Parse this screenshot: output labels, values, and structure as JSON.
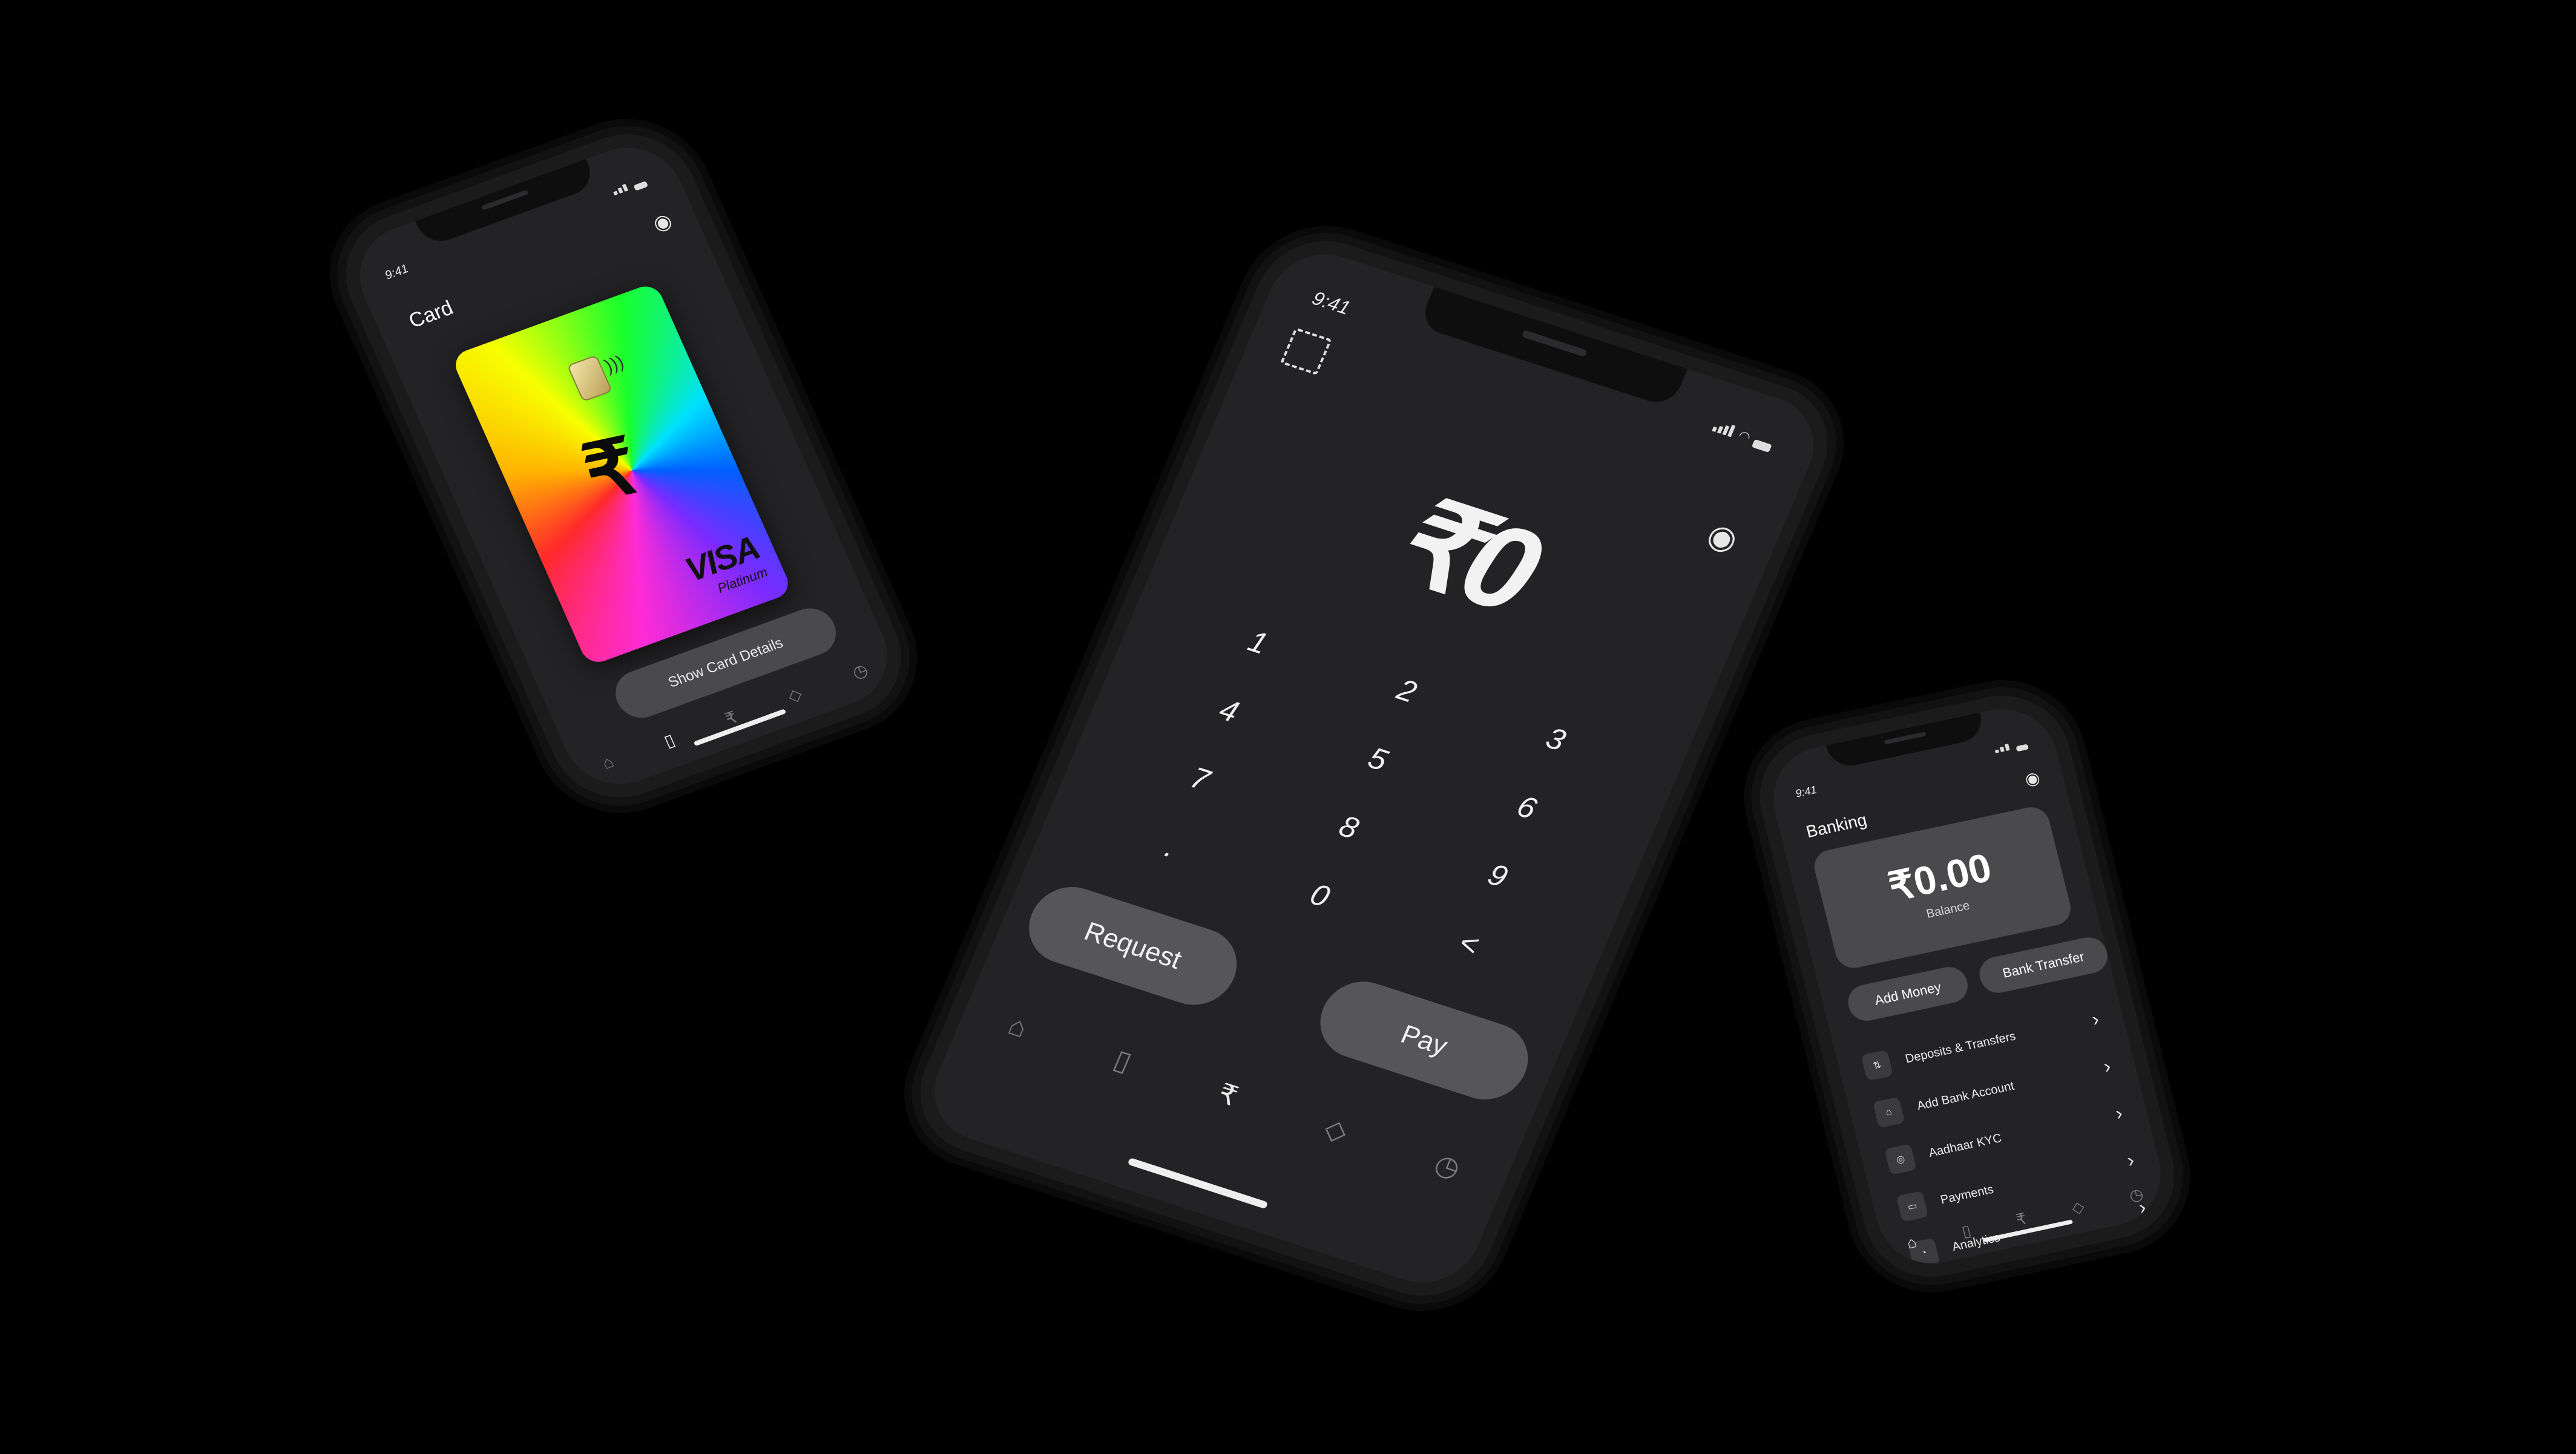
{
  "status_time": "9:41",
  "left_phone": {
    "title": "Card",
    "card": {
      "brand": "VISA",
      "tier": "Platinum",
      "symbol": "₹"
    },
    "show_details_label": "Show Card Details",
    "tabs": [
      {
        "icon": "home-icon",
        "glyph": "⌂",
        "active": false
      },
      {
        "icon": "card-icon",
        "glyph": "▯",
        "active": true
      },
      {
        "icon": "rupee-icon",
        "glyph": "₹",
        "active": false
      },
      {
        "icon": "tag-icon",
        "glyph": "◇",
        "active": false
      },
      {
        "icon": "clock-icon",
        "glyph": "◷",
        "active": false
      }
    ]
  },
  "center_phone": {
    "amount": "₹0",
    "keys": [
      "1",
      "2",
      "3",
      "4",
      "5",
      "6",
      "7",
      "8",
      "9",
      ".",
      "0",
      "<"
    ],
    "request_label": "Request",
    "pay_label": "Pay",
    "tabs": [
      {
        "icon": "bank-icon",
        "glyph": "⌂",
        "active": false
      },
      {
        "icon": "card-icon",
        "glyph": "▯",
        "active": false
      },
      {
        "icon": "rupee-icon",
        "glyph": "₹",
        "active": true
      },
      {
        "icon": "tag-icon",
        "glyph": "◇",
        "active": false
      },
      {
        "icon": "clock-icon",
        "glyph": "◷",
        "active": false
      }
    ]
  },
  "right_phone": {
    "title": "Banking",
    "balance": "₹0.00",
    "balance_label": "Balance",
    "add_money_label": "Add Money",
    "bank_transfer_label": "Bank Transfer",
    "menu": [
      {
        "label": "Deposits & Transfers",
        "icon": "arrows-icon",
        "glyph": "⇅"
      },
      {
        "label": "Add Bank Account",
        "icon": "bank-icon",
        "glyph": "⌂"
      },
      {
        "label": "Aadhaar KYC",
        "icon": "fingerprint-icon",
        "glyph": "◎"
      },
      {
        "label": "Payments",
        "icon": "payments-icon",
        "glyph": "▭"
      },
      {
        "label": "Analytics",
        "icon": "analytics-icon",
        "glyph": "◔"
      }
    ],
    "tabs": [
      {
        "icon": "home-icon",
        "glyph": "⌂",
        "active": true
      },
      {
        "icon": "card-icon",
        "glyph": "▯",
        "active": false
      },
      {
        "icon": "rupee-icon",
        "glyph": "₹",
        "active": false
      },
      {
        "icon": "tag-icon",
        "glyph": "◇",
        "active": false
      },
      {
        "icon": "clock-icon",
        "glyph": "◷",
        "active": false
      }
    ]
  }
}
